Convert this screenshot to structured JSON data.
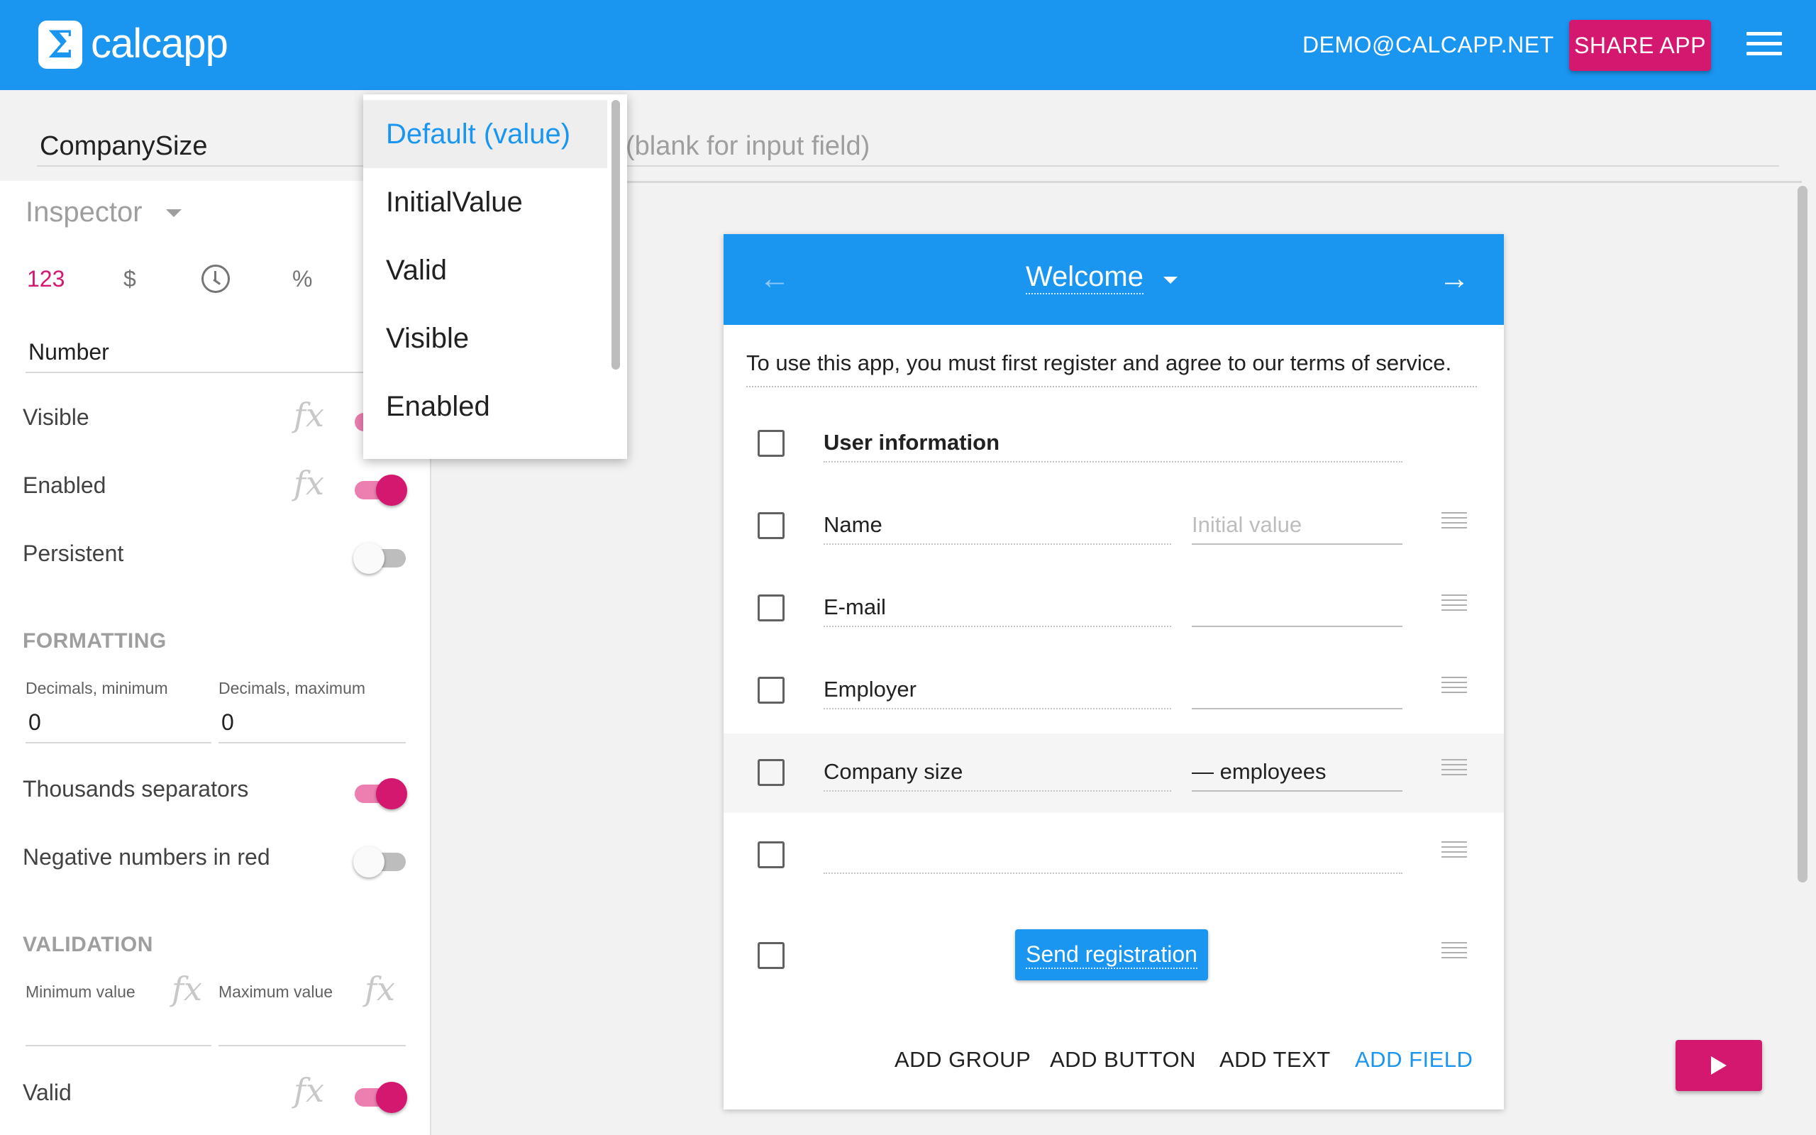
{
  "header": {
    "app_name": "calcapp",
    "logo_glyph": "Σ",
    "user_email": "DEMO@CALCAPP.NET",
    "share_label": "SHARE APP",
    "brand_color": "#1a96f0",
    "accent_color": "#d4176f"
  },
  "formula_bar": {
    "name_value": "CompanySize",
    "formula_placeholder": "(blank for input field)"
  },
  "property_dropdown": {
    "items": [
      "Default (value)",
      "InitialValue",
      "Valid",
      "Visible",
      "Enabled"
    ],
    "selected": "Default (value)"
  },
  "inspector": {
    "title": "Inspector",
    "format_icons": {
      "number": "123",
      "currency": "$",
      "time": "clock-icon",
      "percent": "%"
    },
    "field_type": "Number",
    "properties": [
      {
        "label": "Visible",
        "on": true
      },
      {
        "label": "Enabled",
        "on": true
      },
      {
        "label": "Persistent",
        "on": false
      }
    ],
    "fx_symbol": "fx",
    "formatting": {
      "heading": "FORMATTING",
      "decimals_min_label": "Decimals, minimum",
      "decimals_min_value": "0",
      "decimals_max_label": "Decimals, maximum",
      "decimals_max_value": "0",
      "thousands_label": "Thousands separators",
      "thousands_on": true,
      "negative_red_label": "Negative numbers in red",
      "negative_red_on": false
    },
    "validation": {
      "heading": "VALIDATION",
      "min_label": "Minimum value",
      "max_label": "Maximum value",
      "valid_label": "Valid",
      "valid_on": true
    }
  },
  "app_preview": {
    "page_title": "Welcome",
    "intro_text": "To use this app, you must first register and agree to our terms of service.",
    "group_label": "User information",
    "rows": [
      {
        "label": "Name",
        "value": "Initial value",
        "placeholder": true
      },
      {
        "label": "E-mail",
        "value": ""
      },
      {
        "label": "Employer",
        "value": ""
      },
      {
        "label": "Company size",
        "value": "— employees",
        "highlight": true
      },
      {
        "label": "",
        "value": ""
      }
    ],
    "button_label": "Send registration",
    "actions": {
      "add_group": "ADD GROUP",
      "add_button": "ADD BUTTON",
      "add_text": "ADD TEXT",
      "add_field": "ADD FIELD"
    }
  }
}
